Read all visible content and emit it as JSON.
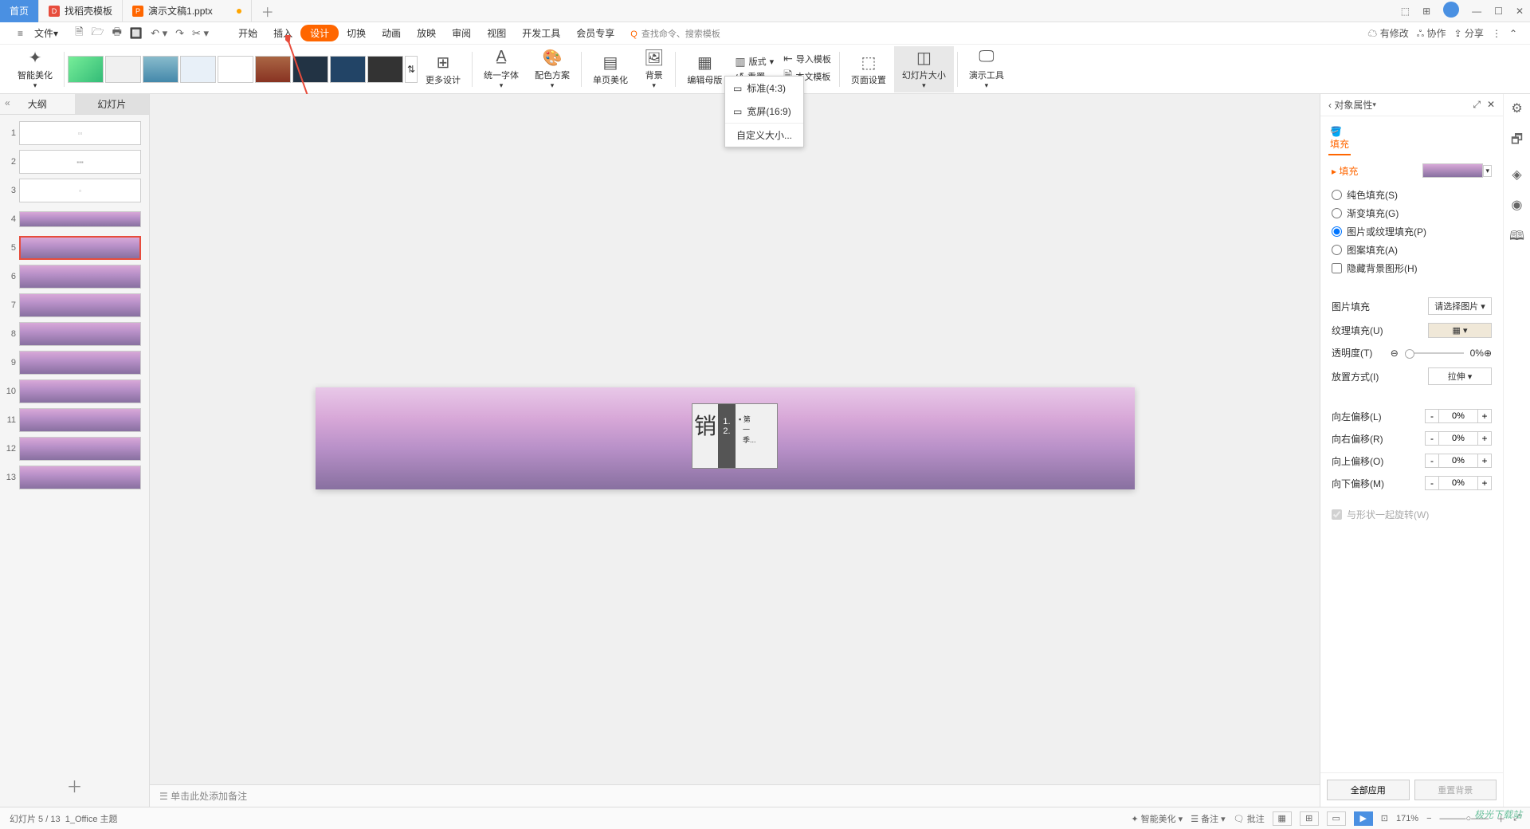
{
  "titlebar": {
    "home": "首页",
    "tab1": "找稻壳模板",
    "tab2": "演示文稿1.pptx"
  },
  "wincontrols": {
    "min": "—",
    "max": "☐",
    "close": "✕"
  },
  "menu": {
    "file": "文件",
    "items": [
      "开始",
      "插入",
      "设计",
      "切换",
      "动画",
      "放映",
      "审阅",
      "视图",
      "开发工具",
      "会员专享"
    ],
    "active_index": 2,
    "search_placeholder": "查找命令、搜索模板",
    "search_prefix": "Q",
    "has_mod": "有修改",
    "coop": "协作",
    "share": "分享"
  },
  "ribbon": {
    "beautify": "智能美化",
    "more_design": "更多设计",
    "unify_font": "统一字体",
    "color_scheme": "配色方案",
    "page_beautify": "单页美化",
    "background": "背景",
    "edit_master": "编辑母版",
    "layout": "版式",
    "import_tpl": "导入模板",
    "reset": "重置",
    "this_tpl": "本文模板",
    "page_setup": "页面设置",
    "slide_size": "幻灯片大小",
    "present_tools": "演示工具"
  },
  "dropdown": {
    "std": "标准(4:3)",
    "wide": "宽屏(16:9)",
    "custom": "自定义大小..."
  },
  "sidepanel": {
    "tab_outline": "大纲",
    "tab_slides": "幻灯片",
    "count": 13,
    "selected": 5,
    "addslide": "＋"
  },
  "slidecontent": {
    "big": "销",
    "list1": "1.",
    "list2": "2.",
    "r1": "第",
    "r2": "一",
    "r3": "季..."
  },
  "notes": {
    "placeholder": "单击此处添加备注"
  },
  "rpanel": {
    "title": "对象属性",
    "tab_fill": "填充",
    "sec_fill": "填充",
    "fill_solid": "纯色填充(S)",
    "fill_grad": "渐变填充(G)",
    "fill_pic": "图片或纹理填充(P)",
    "fill_pattern": "图案填充(A)",
    "hide_bg": "隐藏背景图形(H)",
    "pic_fill": "图片填充",
    "pic_fill_val": "请选择图片",
    "tex_fill": "纹理填充(U)",
    "transparency": "透明度(T)",
    "transparency_val": "0%",
    "place_mode": "放置方式(I)",
    "place_mode_val": "拉伸",
    "off_left": "向左偏移(L)",
    "off_right": "向右偏移(R)",
    "off_top": "向上偏移(O)",
    "off_bottom": "向下偏移(M)",
    "offset_val": "0%",
    "rotate": "与形状一起旋转(W)",
    "apply_all": "全部应用",
    "reset_bg": "重置背景"
  },
  "statusbar": {
    "pos": "幻灯片 5 / 13",
    "theme": "1_Office 主题",
    "beautify": "智能美化",
    "notes": "备注",
    "comments": "批注",
    "zoom": "171%"
  },
  "watermark": "极光下载站"
}
